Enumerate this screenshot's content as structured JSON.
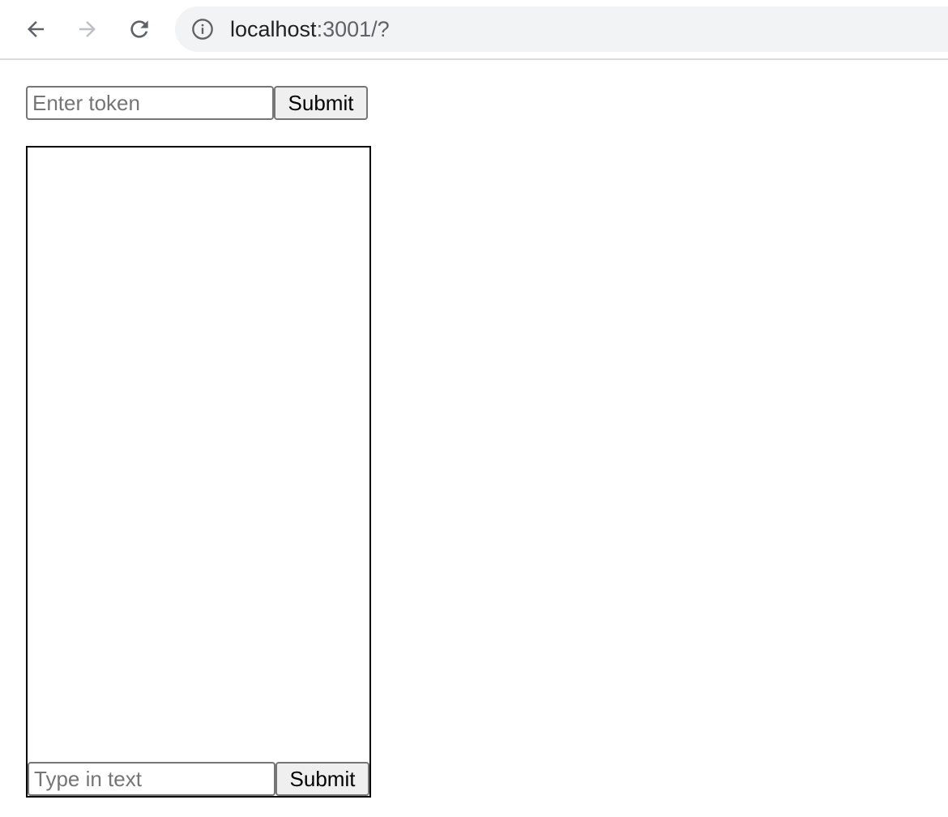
{
  "browser": {
    "url_host": "localhost",
    "url_rest": ":3001/?",
    "icons": {
      "back": "arrow-left-icon",
      "forward": "arrow-right-icon",
      "reload": "reload-icon",
      "site_info": "info-circle-icon"
    },
    "forward_enabled": false
  },
  "token_form": {
    "placeholder": "Enter token",
    "value": "",
    "submit_label": "Submit"
  },
  "chat": {
    "messages": [],
    "input_placeholder": "Type in text",
    "input_value": "",
    "submit_label": "Submit"
  },
  "colors": {
    "omnibox_bg": "#f1f3f4",
    "button_bg": "#efefef",
    "border": "#767676",
    "chat_border": "#000000"
  }
}
